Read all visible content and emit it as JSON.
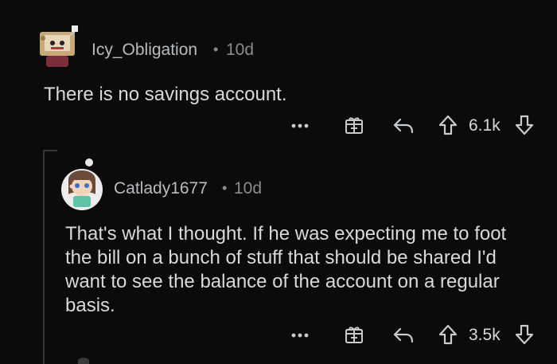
{
  "comments": [
    {
      "username": "Icy_Obligation",
      "age": "10d",
      "separator": "•",
      "body": "There is no savings account.",
      "score": "6.1k",
      "icons": {
        "more": "more-options-icon",
        "award": "award-icon",
        "reply": "reply-icon",
        "upvote": "upvote-icon",
        "downvote": "downvote-icon"
      }
    },
    {
      "username": "Catlady1677",
      "age": "10d",
      "separator": "•",
      "body": "That's what I thought. If he was expecting me to foot the bill on a bunch of stuff that should be shared I'd want to see the balance of the account on a regular basis.",
      "score": "3.5k",
      "icons": {
        "more": "more-options-icon",
        "award": "award-icon",
        "reply": "reply-icon",
        "upvote": "upvote-icon",
        "downvote": "downvote-icon"
      }
    }
  ],
  "colors": {
    "background": "#0b0b0b",
    "text": "#d7dadc",
    "muted": "#8a8d90",
    "thread_line": "#343536"
  }
}
